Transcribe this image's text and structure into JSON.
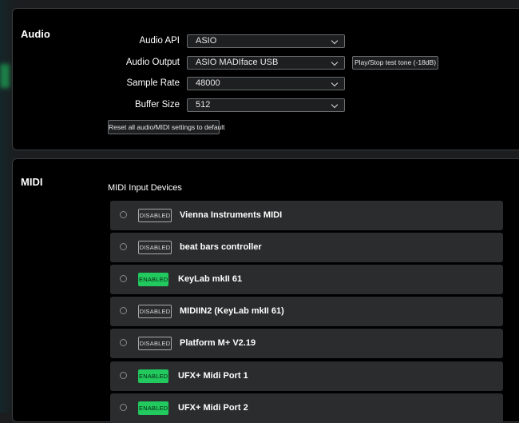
{
  "audio": {
    "title": "Audio",
    "rows": [
      {
        "label": "Audio API",
        "value": "ASIO"
      },
      {
        "label": "Audio Output",
        "value": "ASIO MADIface USB"
      },
      {
        "label": "Sample Rate",
        "value": "48000"
      },
      {
        "label": "Buffer Size",
        "value": "512"
      }
    ],
    "test_tone_label": "Play/Stop test tone (-18dB)",
    "reset_label": "Reset all audio/MIDI settings to default"
  },
  "midi": {
    "title": "MIDI",
    "subtitle": "MIDI Input Devices",
    "devices": [
      {
        "name": "Vienna Instruments MIDI",
        "status": "DISABLED"
      },
      {
        "name": "beat bars controller",
        "status": "DISABLED"
      },
      {
        "name": "KeyLab mkII 61",
        "status": "ENABLED"
      },
      {
        "name": "MIDIIN2 (KeyLab mkII 61)",
        "status": "DISABLED"
      },
      {
        "name": "Platform M+ V2.19",
        "status": "DISABLED"
      },
      {
        "name": "UFX+ Midi Port 1",
        "status": "ENABLED"
      },
      {
        "name": "UFX+ Midi Port 2",
        "status": "ENABLED"
      }
    ]
  },
  "colors": {
    "enabled_badge": "#21c95e",
    "panel_background": "#000000",
    "device_row": "#2b2c2d"
  }
}
